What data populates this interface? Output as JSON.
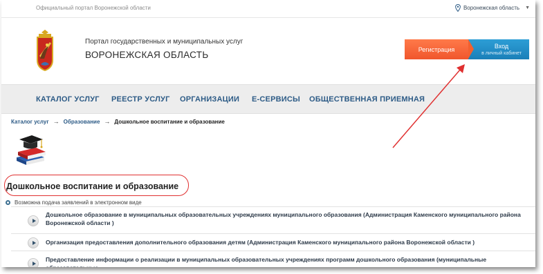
{
  "topbar": {
    "portal_text": "Официальный портал Воронежской области",
    "region": "Воронежская область"
  },
  "header": {
    "subtitle": "Портал государственных и муниципальных услуг",
    "title": "ВОРОНЕЖСКАЯ ОБЛАСТЬ"
  },
  "auth": {
    "register_label": "Регистрация",
    "login_label": "Вход",
    "login_sub": "в личный кабинет"
  },
  "nav": {
    "items": [
      {
        "label": "КАТАЛОГ УСЛУГ"
      },
      {
        "label": "РЕЕСТР УСЛУГ"
      },
      {
        "label": "ОРГАНИЗАЦИИ"
      },
      {
        "label": "Е-СЕРВИСЫ"
      },
      {
        "label": "ОБЩЕСТВЕННАЯ ПРИЕМНАЯ"
      }
    ]
  },
  "breadcrumb": {
    "items": [
      "Каталог услуг",
      "Образование"
    ],
    "current": "Дошкольное воспитание и образование"
  },
  "category": {
    "title": "Дошкольное воспитание и образование",
    "note": "Возможна подача заявлений в электронном виде"
  },
  "services": [
    {
      "text": "Дошкольное образование в муниципальных образовательных учреждениях муниципального образования (Администрация Каменского муниципального района Воронежской области )"
    },
    {
      "text": "Организация предоставления дополнительного образования детям (Администрация Каменского муниципального района Воронежской области )"
    },
    {
      "text": "Предоставление информации о реализации в муниципальных образовательных учреждениях программ дошкольного образования (муниципальные образовательные"
    }
  ],
  "colors": {
    "nav_bg": "#ededed",
    "nav_text": "#2d5b86",
    "register_btn": "#f0562c",
    "login_btn": "#1a7fb8",
    "annotation_red": "#e03030"
  },
  "icons": {
    "region": "map-pin-icon",
    "emblem": "voronezh-coat-of-arms",
    "category": "books-graduation-cap-icon",
    "service": "play-arrow-icon",
    "note": "info-dot-icon"
  }
}
